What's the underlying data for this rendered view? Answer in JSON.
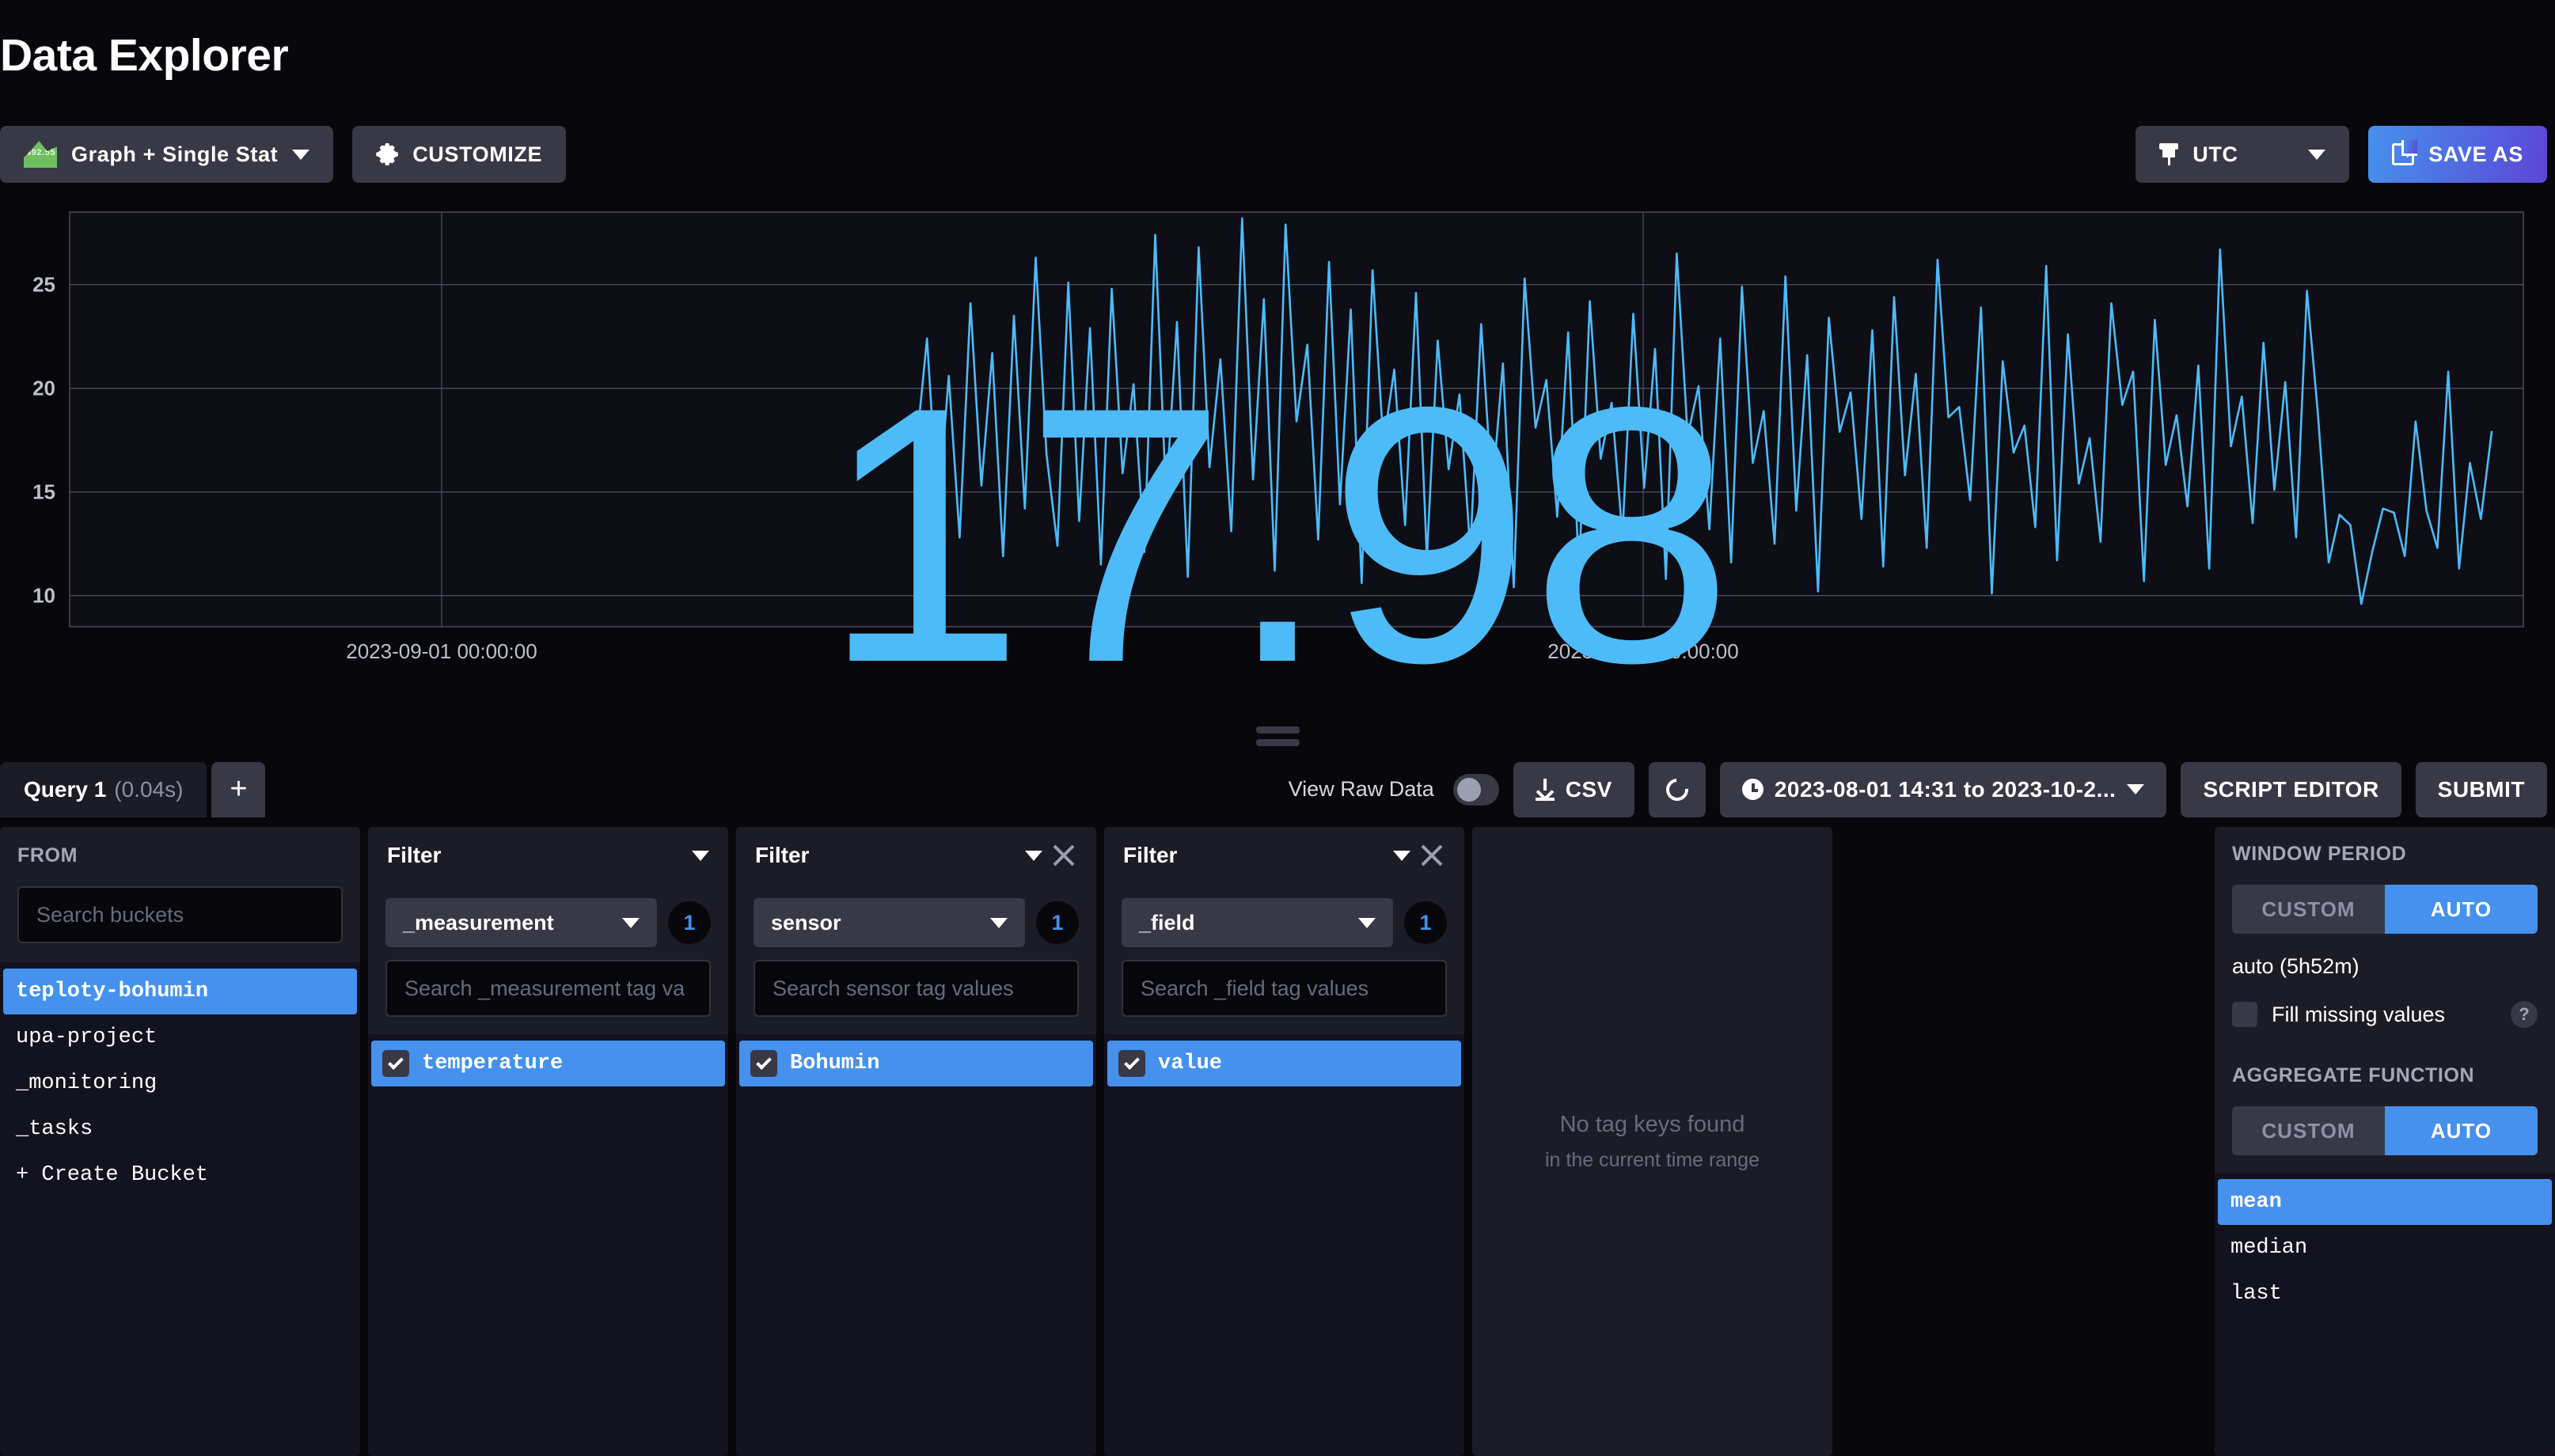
{
  "header": {
    "title": "Data Explorer"
  },
  "toolbar": {
    "viz_type": "Graph + Single Stat",
    "viz_icon_value": "492.55",
    "customize_label": "CUSTOMIZE",
    "timezone_label": "UTC",
    "save_as_label": "SAVE AS"
  },
  "chart_data": {
    "type": "line",
    "title": "",
    "single_stat": "17.98",
    "xlabel": "",
    "ylabel": "",
    "ylim": [
      8.5,
      28.5
    ],
    "yticks": [
      25,
      20,
      15,
      10
    ],
    "xticks": [
      "2023-09-01 00:00:00",
      "2023-10-01 00:00:00"
    ],
    "x_range": [
      "2023-08-01 14:31",
      "2023-10-2..."
    ],
    "grid": true,
    "legend": "none",
    "line_color": "#4dbbf7",
    "series": [
      {
        "name": "temperature value (Bohumin)",
        "values": [
          17.1,
          22.4,
          13.9,
          20.6,
          12.8,
          24.1,
          15.3,
          21.7,
          11.9,
          23.5,
          14.2,
          26.3,
          16.8,
          12.4,
          25.1,
          13.6,
          22.9,
          11.5,
          24.8,
          15.9,
          20.2,
          12.1,
          27.4,
          14.7,
          23.2,
          10.9,
          26.8,
          16.2,
          21.4,
          13.1,
          28.2,
          15.6,
          24.3,
          11.2,
          27.9,
          18.4,
          22.1,
          12.7,
          26.1,
          14.4,
          23.8,
          10.6,
          25.7,
          17.3,
          20.9,
          13.4,
          24.6,
          11.8,
          22.3,
          16.1,
          19.7,
          12.2,
          23.1,
          14.9,
          21.2,
          10.4,
          25.3,
          18.1,
          20.4,
          13.8,
          22.7,
          11.1,
          24.2,
          16.6,
          19.3,
          12.9,
          23.6,
          15.2,
          21.9,
          10.8,
          26.5,
          17.7,
          20.1,
          13.2,
          22.4,
          11.6,
          24.9,
          16.4,
          18.9,
          12.5,
          25.4,
          14.1,
          21.6,
          10.2,
          23.4,
          17.9,
          19.8,
          13.7,
          22.8,
          11.4,
          24.4,
          15.8,
          20.7,
          12.3,
          26.2,
          18.6,
          19.1,
          14.6,
          23.9,
          10.1,
          21.3,
          16.9,
          18.2,
          13.3,
          25.9,
          11.7,
          22.6,
          15.4,
          17.6,
          12.6,
          24.1,
          19.2,
          20.8,
          10.7,
          23.3,
          16.3,
          18.7,
          14.3,
          21.1,
          11.3,
          26.7,
          17.2,
          19.6,
          13.5,
          22.2,
          15.1,
          20.3,
          12.8,
          24.7,
          18.8,
          11.6,
          13.9,
          13.4,
          9.6,
          12.1,
          14.2,
          14.0,
          11.9,
          18.4,
          14.1,
          12.3,
          20.8,
          11.3,
          16.4,
          13.7,
          17.9
        ]
      }
    ]
  },
  "query_toolbar": {
    "query_tab_name": "Query 1",
    "query_tab_time": "(0.04s)",
    "add_query_label": "+",
    "view_raw_data_label": "View Raw Data",
    "csv_label": "CSV",
    "time_range": "2023-08-01 14:31 to 2023-10-2...",
    "script_editor_label": "SCRIPT EDITOR",
    "submit_label": "SUBMIT"
  },
  "from_column": {
    "label": "FROM",
    "search_placeholder": "Search buckets",
    "buckets": [
      {
        "name": "teploty-bohumin",
        "selected": true
      },
      {
        "name": "upa-project",
        "selected": false
      },
      {
        "name": "_monitoring",
        "selected": false
      },
      {
        "name": "_tasks",
        "selected": false
      }
    ],
    "create_bucket_label": "+ Create Bucket"
  },
  "filters": [
    {
      "title": "Filter",
      "tag_key": "_measurement",
      "count": "1",
      "search_placeholder": "Search _measurement tag va",
      "closable": false,
      "values": [
        {
          "label": "temperature",
          "checked": true
        }
      ]
    },
    {
      "title": "Filter",
      "tag_key": "sensor",
      "count": "1",
      "search_placeholder": "Search sensor tag values",
      "closable": true,
      "values": [
        {
          "label": "Bohumin",
          "checked": true
        }
      ]
    },
    {
      "title": "Filter",
      "tag_key": "_field",
      "count": "1",
      "search_placeholder": "Search _field tag values",
      "closable": true,
      "values": [
        {
          "label": "value",
          "checked": true
        }
      ]
    }
  ],
  "empty_column": {
    "main": "No tag keys found",
    "sub": "in the current time range"
  },
  "right_panel": {
    "window_period": {
      "label": "WINDOW PERIOD",
      "custom_label": "CUSTOM",
      "auto_label": "AUTO",
      "active": "AUTO",
      "value": "auto (5h52m)",
      "fill_missing_label": "Fill missing values",
      "help_glyph": "?"
    },
    "aggregate_function": {
      "label": "AGGREGATE FUNCTION",
      "custom_label": "CUSTOM",
      "auto_label": "AUTO",
      "active": "AUTO",
      "options": [
        {
          "name": "mean",
          "selected": true
        },
        {
          "name": "median",
          "selected": false
        },
        {
          "name": "last",
          "selected": false
        }
      ]
    }
  },
  "colors": {
    "accent_blue": "#4591ed",
    "line_blue": "#4dbbf7",
    "panel": "#1c1c27",
    "background": "#07070c"
  }
}
